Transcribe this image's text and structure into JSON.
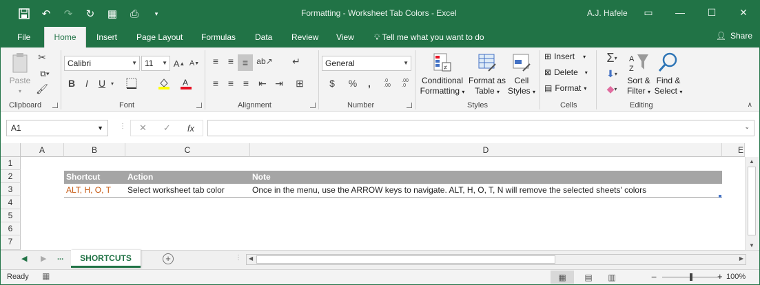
{
  "window": {
    "title": "Formatting - Worksheet Tab Colors  -  Excel",
    "user": "A.J. Hafele",
    "min_icon": "minimize-icon",
    "max_icon": "maximize-icon",
    "close_icon": "close-icon"
  },
  "ribbon_tabs": [
    "File",
    "Home",
    "Insert",
    "Page Layout",
    "Formulas",
    "Data",
    "Review",
    "View"
  ],
  "tell_me": "Tell me what you want to do",
  "share": "Share",
  "clipboard": {
    "paste": "Paste",
    "label": "Clipboard"
  },
  "font": {
    "name": "Calibri",
    "size": "11",
    "label": "Font",
    "bold": "B",
    "italic": "I",
    "underline": "U"
  },
  "alignment": {
    "label": "Alignment"
  },
  "number": {
    "format": "General",
    "label": "Number",
    "currency": "$",
    "percent": "%",
    "comma": ",",
    "inc_dec": ".00→.0",
    "dec_dec": ".0→.00"
  },
  "styles": {
    "label": "Styles",
    "conditional_line1": "Conditional",
    "conditional_line2": "Formatting",
    "format_table_line1": "Format as",
    "format_table_line2": "Table",
    "cell_styles_line1": "Cell",
    "cell_styles_line2": "Styles"
  },
  "cells": {
    "label": "Cells",
    "insert": "Insert",
    "delete": "Delete",
    "format": "Format"
  },
  "editing": {
    "label": "Editing",
    "sort_line1": "Sort &",
    "sort_line2": "Filter",
    "find_line1": "Find &",
    "find_line2": "Select"
  },
  "formula_bar": {
    "name_box": "A1",
    "cancel": "✕",
    "enter": "✓",
    "fx": "fx",
    "value": ""
  },
  "columns": [
    "A",
    "B",
    "C",
    "D",
    "E"
  ],
  "rows": [
    "1",
    "2",
    "3",
    "4",
    "5",
    "6",
    "7"
  ],
  "table": {
    "headers": [
      "Shortcut",
      "Action",
      "Note"
    ],
    "rows": [
      [
        "ALT, H, O, T",
        "Select worksheet tab color",
        "Once in the menu, use the ARROW keys to navigate.  ALT, H, O, T, N will remove the selected sheets' colors"
      ]
    ]
  },
  "sheets": {
    "ellipsis": "...",
    "active": "SHORTCUTS"
  },
  "status": {
    "ready": "Ready",
    "zoom": "100%",
    "zoom_level": 1.0
  },
  "colors": {
    "accent": "#217346",
    "header_fill": "#a5a5a5",
    "shortcut_text": "#c65911"
  }
}
